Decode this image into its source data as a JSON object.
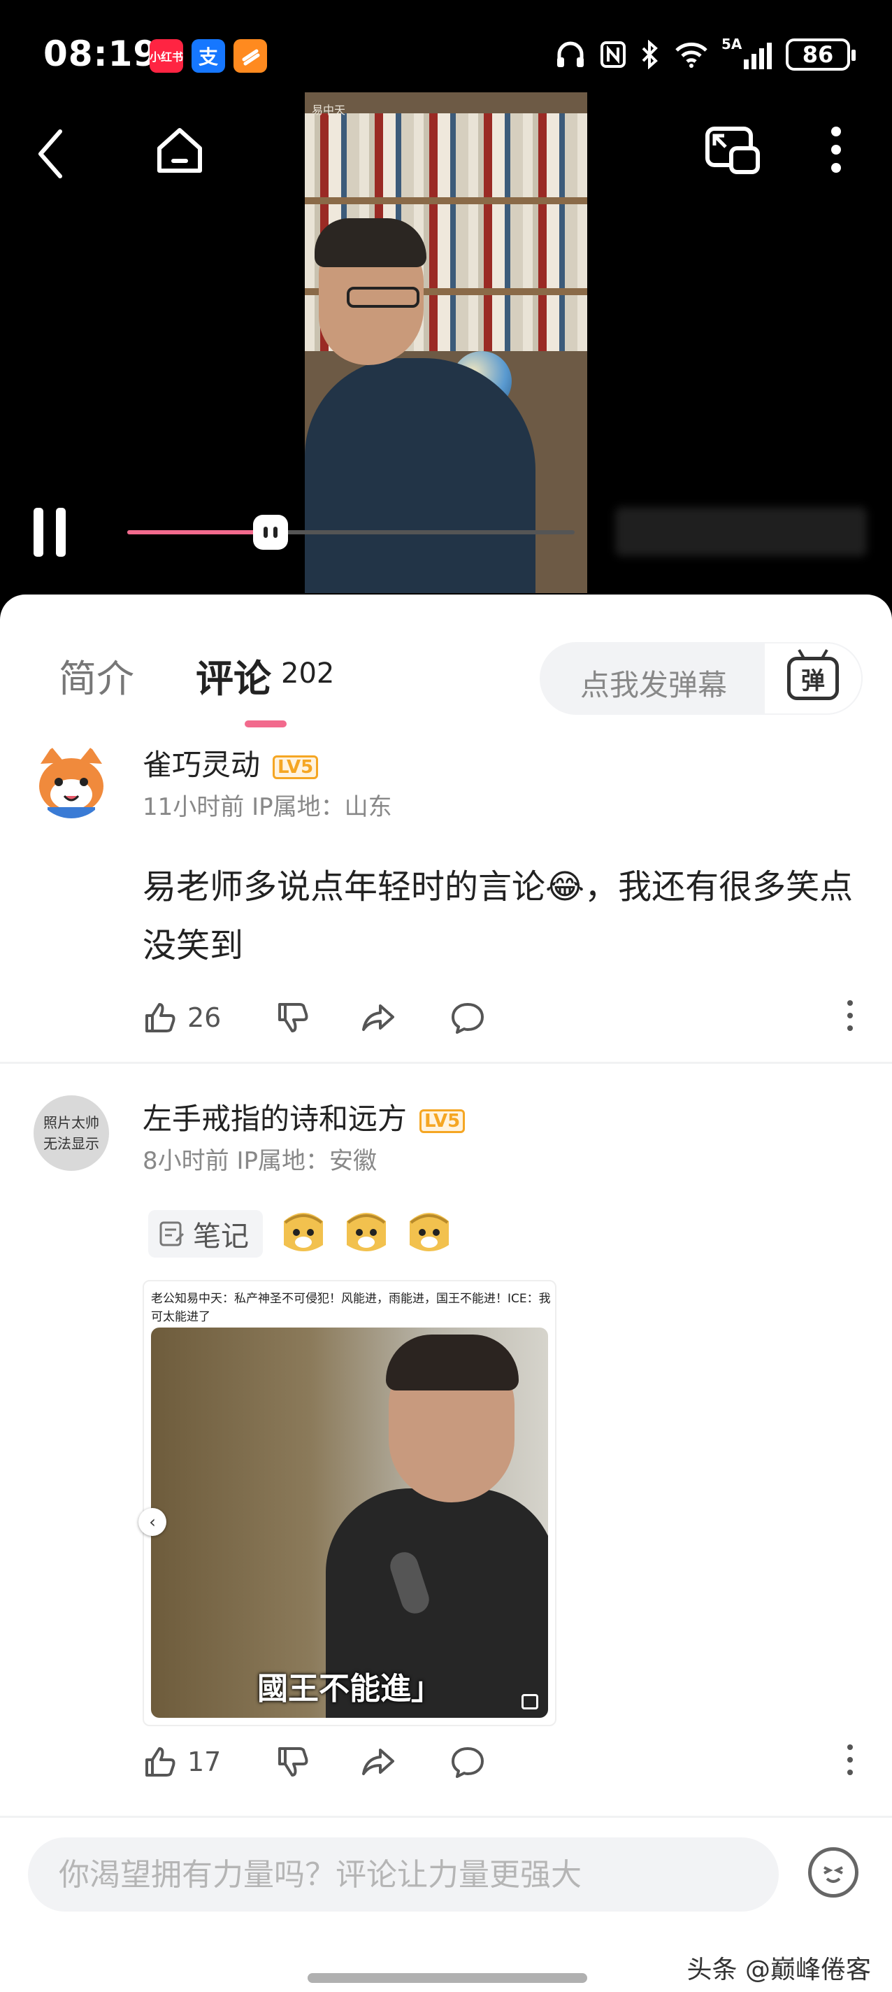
{
  "status_bar": {
    "time": "08:19",
    "apps": [
      {
        "name": "xiaohongshu-app",
        "label": "小红书",
        "color": "#ff2442"
      },
      {
        "name": "alipay-app",
        "label": "支",
        "color": "#1677ff"
      },
      {
        "name": "orange-app",
        "label": "",
        "color": "#ff8a1f"
      }
    ],
    "network": "5A",
    "battery": "86"
  },
  "video": {
    "uploader_watermark": "易中天",
    "progress": 0.32,
    "icons": [
      "back-icon",
      "home-icon",
      "picture-in-picture-icon",
      "more-icon",
      "pause-icon"
    ]
  },
  "tabs": {
    "intro": "简介",
    "comments": "评论",
    "comment_count": "202"
  },
  "danmaku": {
    "placeholder": "点我发弹幕",
    "button_label": "弹"
  },
  "comments": [
    {
      "username": "雀巧灵动",
      "level": "LV5",
      "meta": "11小时前 IP属地：山东",
      "text": "易老师多说点年轻时的言论😂，我还有很多笑点没笑到",
      "likes": "26"
    },
    {
      "username": "左手戒指的诗和远方",
      "level": "LV5",
      "avatar_text_1": "照片太帅",
      "avatar_text_2": "无法显示",
      "meta": "8小时前 IP属地：安徽",
      "note_label": "笔记",
      "meme_caption": "老公知易中天：私产神圣不可侵犯！风能进，雨能进，国王不能进！ICE：我可太能进了",
      "meme_subtitle": "國王不能進」",
      "likes": "17"
    }
  ],
  "input": {
    "placeholder": "你渴望拥有力量吗？评论让力量更强大"
  },
  "source_watermark": "头条 @巅峰倦客"
}
